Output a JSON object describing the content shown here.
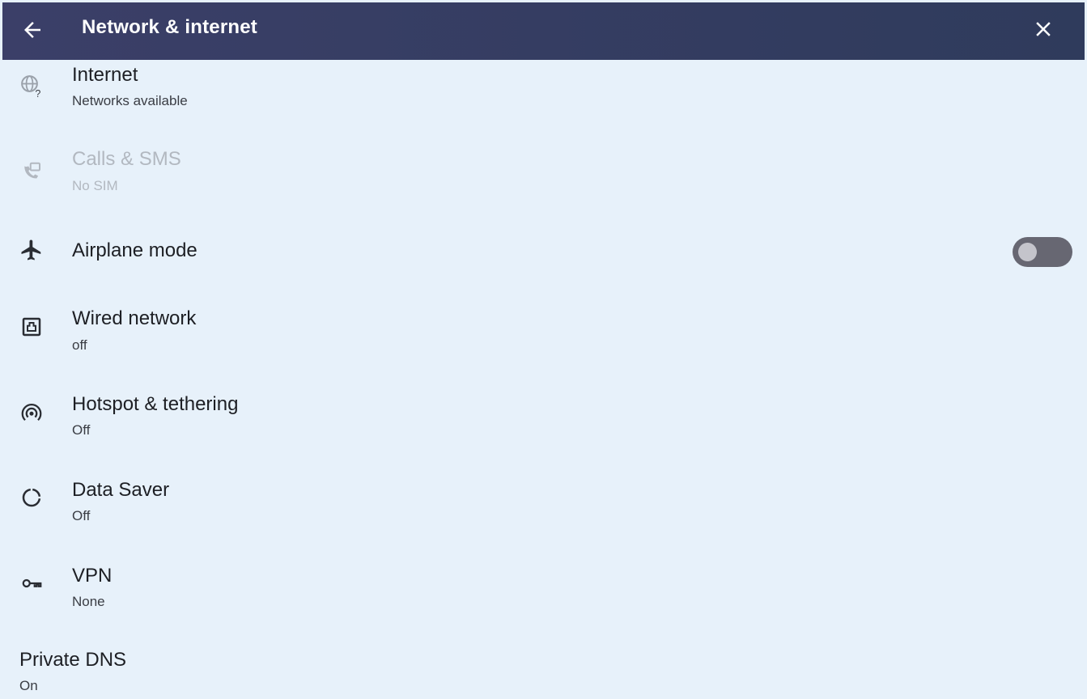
{
  "header": {
    "title": "Network & internet",
    "back_icon": "arrow-back-icon",
    "close_icon": "close-icon",
    "background": "#353d63"
  },
  "items": [
    {
      "id": "internet",
      "icon": "globe-question-icon",
      "title": "Internet",
      "summary": "Networks available",
      "enabled": true
    },
    {
      "id": "calls-sms",
      "icon": "phone-sms-icon",
      "title": "Calls & SMS",
      "summary": "No SIM",
      "enabled": false
    },
    {
      "id": "airplane-mode",
      "icon": "airplane-icon",
      "title": "Airplane mode",
      "summary": "",
      "toggle": {
        "on": false
      }
    },
    {
      "id": "wired-network",
      "icon": "ethernet-icon",
      "title": "Wired network",
      "summary": "off",
      "enabled": true
    },
    {
      "id": "hotspot",
      "icon": "hotspot-icon",
      "title": "Hotspot & tethering",
      "summary": "Off",
      "enabled": true
    },
    {
      "id": "data-saver",
      "icon": "data-saver-icon",
      "title": "Data Saver",
      "summary": "Off",
      "enabled": true
    },
    {
      "id": "vpn",
      "icon": "vpn-key-icon",
      "title": "VPN",
      "summary": "None",
      "enabled": true
    },
    {
      "id": "private-dns",
      "icon": "",
      "title": "Private DNS",
      "summary": "On",
      "enabled": true
    }
  ],
  "colors": {
    "background": "#e7f1fa",
    "text_primary": "#1d1f24",
    "text_disabled": "#b2b8c0",
    "toggle_track_off": "#676772"
  }
}
